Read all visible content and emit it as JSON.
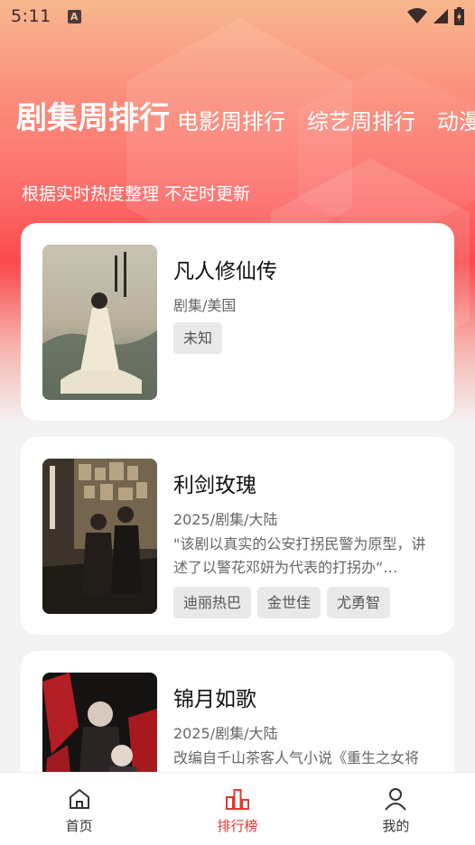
{
  "status_bar": {
    "time": "5:11",
    "notification_icon": "A",
    "icons": [
      "wifi-icon",
      "signal-icon",
      "battery-charging-icon"
    ]
  },
  "tabs": [
    {
      "label": "剧集周排行",
      "active": true
    },
    {
      "label": "电影周排行",
      "active": false
    },
    {
      "label": "综艺周排行",
      "active": false
    },
    {
      "label": "动漫",
      "active": false
    }
  ],
  "subtitle": "根据实时热度整理 不定时更新",
  "items": [
    {
      "title": "凡人修仙传",
      "meta": "剧集/美国",
      "description": "",
      "tags": [
        "未知"
      ]
    },
    {
      "title": "利剑玫瑰",
      "meta": "2025/剧集/大陆",
      "description": "\"该剧以真实的公安打拐民警为原型，讲述了以警花邓妍为代表的打拐办“…",
      "tags": [
        "迪丽热巴",
        "金世佳",
        "尤勇智"
      ]
    },
    {
      "title": "锦月如歌",
      "meta": "2025/剧集/大陆",
      "description": "改编自千山茶客人气小说《重生之女将星》，为保家族爱侣，千家长女",
      "tags": []
    }
  ],
  "bottom_nav": [
    {
      "label": "首页",
      "icon": "home-icon",
      "active": false
    },
    {
      "label": "排行榜",
      "icon": "ranking-chart-icon",
      "active": true
    },
    {
      "label": "我的",
      "icon": "user-icon",
      "active": false
    }
  ],
  "colors": {
    "accent": "#e0382f",
    "hero_top": "#f8b78e",
    "hero_mid": "#fa4a4d"
  }
}
